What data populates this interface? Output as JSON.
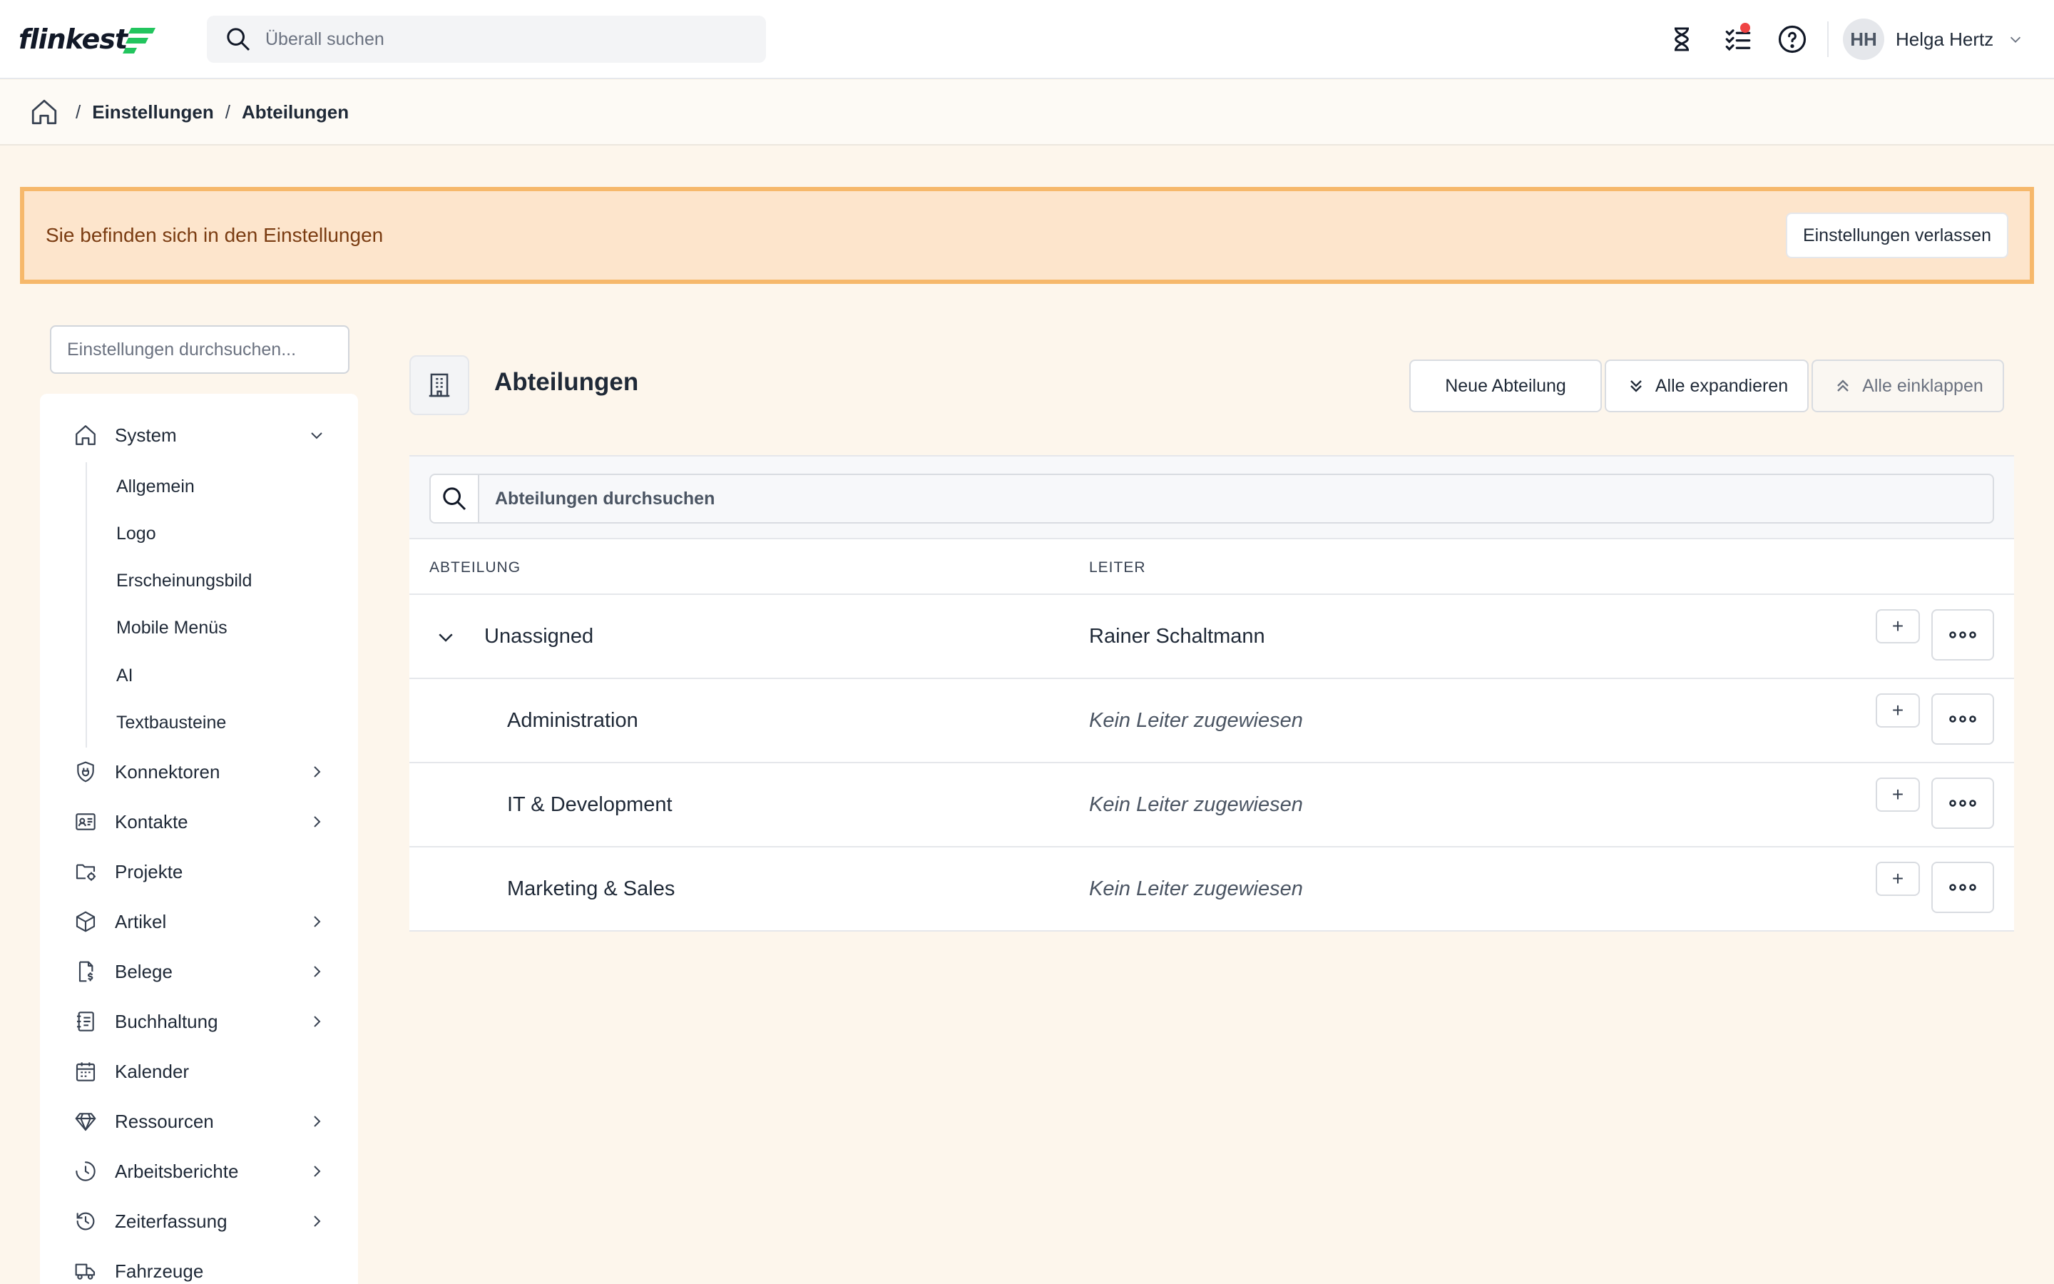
{
  "app": {
    "logo_text": "flinkest",
    "brand_color": "#22c55e",
    "search_placeholder": "Überall suchen",
    "user_initials": "HH",
    "user_name": "Helga Hertz",
    "notification_color": "#ef4444"
  },
  "breadcrumb": [
    "Einstellungen",
    "Abteilungen"
  ],
  "banner": {
    "text": "Sie befinden sich in den Einstellungen",
    "leave_button": "Einstellungen verlassen"
  },
  "sidebar": {
    "search_placeholder": "Einstellungen durchsuchen...",
    "system": {
      "label": "System",
      "expanded": true,
      "children": [
        "Allgemein",
        "Logo",
        "Erscheinungsbild",
        "Mobile Menüs",
        "AI",
        "Textbausteine"
      ]
    },
    "items": [
      {
        "label": "Konnektoren",
        "icon": "plug-shield-icon",
        "has_children": true
      },
      {
        "label": "Kontakte",
        "icon": "contact-card-icon",
        "has_children": true
      },
      {
        "label": "Projekte",
        "icon": "folder-gear-icon",
        "has_children": false
      },
      {
        "label": "Artikel",
        "icon": "box-icon",
        "has_children": true
      },
      {
        "label": "Belege",
        "icon": "receipt-icon",
        "has_children": true
      },
      {
        "label": "Buchhaltung",
        "icon": "ledger-icon",
        "has_children": true
      },
      {
        "label": "Kalender",
        "icon": "calendar-icon",
        "has_children": false
      },
      {
        "label": "Ressourcen",
        "icon": "gem-icon",
        "has_children": true
      },
      {
        "label": "Arbeitsberichte",
        "icon": "clock-icon",
        "has_children": true
      },
      {
        "label": "Zeiterfassung",
        "icon": "history-icon",
        "has_children": true
      },
      {
        "label": "Fahrzeuge",
        "icon": "truck-icon",
        "has_children": false
      }
    ]
  },
  "page": {
    "title": "Abteilungen",
    "buttons": {
      "new": "Neue Abteilung",
      "expand_all": "Alle expandieren",
      "collapse_all": "Alle einklappen"
    },
    "table_search_placeholder": "Abteilungen durchsuchen",
    "columns": {
      "department": "ABTEILUNG",
      "leader": "LEITER"
    },
    "rows": [
      {
        "name": "Unassigned",
        "leader": "Rainer Schaltmann",
        "leader_assigned": true,
        "level": 0,
        "expanded": true
      },
      {
        "name": "Administration",
        "leader": "Kein Leiter zugewiesen",
        "leader_assigned": false,
        "level": 1
      },
      {
        "name": "IT & Development",
        "leader": "Kein Leiter zugewiesen",
        "leader_assigned": false,
        "level": 1
      },
      {
        "name": "Marketing & Sales",
        "leader": "Kein Leiter zugewiesen",
        "leader_assigned": false,
        "level": 1
      }
    ],
    "row_add_symbol": "+"
  }
}
